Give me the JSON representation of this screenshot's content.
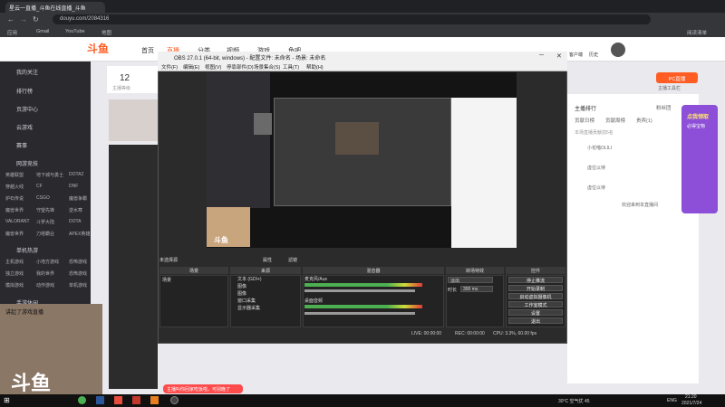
{
  "browser": {
    "tab_title": "星云一直播_斗鱼在线直播_斗鱼",
    "url": "douyu.com/2084316",
    "bookmarks": [
      "应用",
      "Gmail",
      "YouTube",
      "地图"
    ],
    "reading_list": "阅读清单"
  },
  "site": {
    "logo": "斗鱼",
    "nav": [
      "首页",
      "直播",
      "分类",
      "视频",
      "游戏",
      "鱼吧"
    ],
    "header_right": [
      "客户端",
      "历史",
      "关注"
    ]
  },
  "sidebar": {
    "items": [
      "我的关注",
      "排行榜",
      "页游中心",
      "云游戏",
      "赛事"
    ],
    "section_title": "网游竞技",
    "games": [
      "英雄联盟",
      "地下城与勇士",
      "CF",
      "DOTA2",
      "穿越火线",
      "CSGO",
      "DNF",
      "炉石传说",
      "魔兽争霸",
      "魔兽世界",
      "守望先锋",
      "逆水寒",
      "坦克世界",
      "VALORANT",
      "斗罗大陆",
      "DOTA",
      "魔兽世界",
      "刀塔霸业",
      "APEX英雄"
    ],
    "section2": "单机热游",
    "games2": [
      "主机游戏",
      "小地方游戏",
      "恐怖游戏",
      "独立游戏",
      "我的世界",
      "恐怖游戏",
      "模拟游戏",
      "动作游戏",
      "单机游戏"
    ],
    "section3": "手游休闲"
  },
  "streamer": {
    "count": "12",
    "label": "主播等级"
  },
  "obs": {
    "title": "OBS 27.0.1 (64-bit, windows) - 配置文件: 未命名 - 场景: 未命名",
    "menu": [
      "文件(F)",
      "编辑(E)",
      "视图(V)",
      "停靠部件(D)",
      "场景集合(S)",
      "工具(T)",
      "帮助(H)"
    ],
    "no_source": "未选择源",
    "props_btn": "属性",
    "filters_btn": "滤镜",
    "docks": [
      "场景",
      "来源",
      "混音器",
      "转场特效",
      "控件"
    ],
    "scene": "场景",
    "sources": [
      "文本 (GDI+)",
      "图像",
      "图像",
      "窗口采集",
      "显示器采集"
    ],
    "mixer": [
      "麦克风/Aux",
      "桌面音频"
    ],
    "transition": {
      "type": "淡出",
      "duration_label": "时长",
      "duration": "300 ms"
    },
    "controls": [
      "停止推流",
      "开始录制",
      "启动虚拟摄像机",
      "工作室模式",
      "设置",
      "退出"
    ],
    "status": {
      "live": "LIVE: 00:00:00",
      "rec": "REC: 00:00:00",
      "cpu": "CPU: 3.3%, 60.00 fps"
    }
  },
  "right": {
    "pc_live": "PC直播",
    "pc_live_sub": "主播工具栏",
    "tabs": [
      "主播排行",
      "贡献日榜",
      "贡献周榜",
      "贵宾(1)",
      "粉丝团"
    ],
    "rank_note": "本场直播贡献前5名",
    "ranks": [
      "小花喵OLILI",
      "虚位以待",
      "虚位以待"
    ],
    "welcome": "欢迎来到本直播间",
    "promo": [
      "点我领取",
      "必得宝物"
    ]
  },
  "chat": {
    "overlay": "讲起了游戏直播",
    "notify": "主播叫你回家吃饭啦，可别晚了"
  },
  "taskbar": {
    "temp": "30°C 空气优 45",
    "lang": "ENG",
    "time": "21:20",
    "date": "2021/7/24"
  },
  "colors": {
    "accent": "#ff5d23",
    "obs_bg": "#2b2b2b",
    "sidebar_bg": "#2a2a2e"
  }
}
